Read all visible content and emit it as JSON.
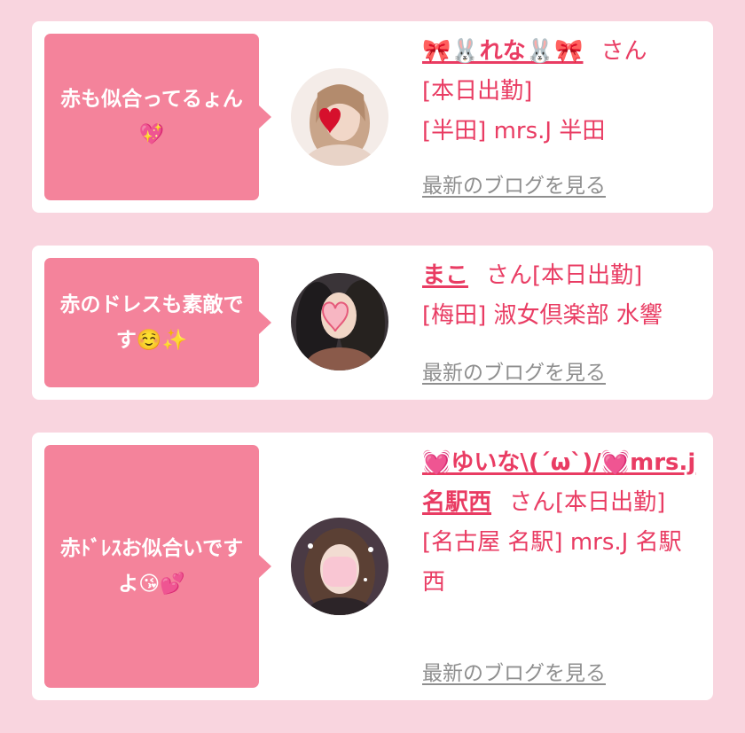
{
  "blog_link_label": "最新のブログを見る",
  "name_suffix": "さん",
  "colors": {
    "background": "#f9d5df",
    "card": "#ffffff",
    "bubble": "#f4839b",
    "accent_text": "#e93c63",
    "link_gray": "#8f8f8f"
  },
  "posts": [
    {
      "comment": "赤も似合ってるょん💖",
      "avatar_icon": "cast-photo-avatar",
      "name": "🎀🐰れな🐰🎀",
      "status": "[本日出勤]",
      "area": "[半田]",
      "shop": "mrs.J 半田"
    },
    {
      "comment": "赤のドレスも素敵です☺️✨",
      "avatar_icon": "cast-photo-avatar",
      "name": "まこ",
      "status": "[本日出勤]",
      "area": "[梅田]",
      "shop": "淑女倶楽部 水響"
    },
    {
      "comment": "赤ﾄﾞﾚｽお似合いですよ😘💕",
      "avatar_icon": "cast-photo-avatar",
      "name": "💓ゆいな\\(´ω`)/💓mrs.j名駅西",
      "status": "[本日出勤]",
      "area": "[名古屋 名駅]",
      "shop": "mrs.J 名駅西"
    }
  ]
}
